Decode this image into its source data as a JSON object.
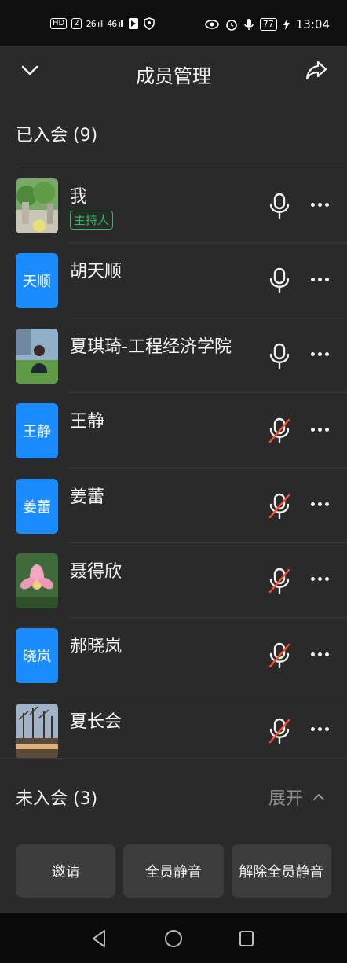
{
  "status_bar": {
    "left_chips": [
      "HD",
      "2"
    ],
    "signal_1": "26 ıll",
    "signal_2": "46 ıll",
    "battery": "77",
    "time": "13:04"
  },
  "header": {
    "title": "成员管理"
  },
  "joined": {
    "label": "已入会 (9)",
    "members": [
      {
        "name": "我",
        "badge": "主持人",
        "avatar_type": "photo-garden",
        "mic": "on"
      },
      {
        "name": "胡天顺",
        "avatar_text": "天顺",
        "avatar_type": "blue",
        "mic": "on"
      },
      {
        "name": "夏琪琦-工程经济学院",
        "avatar_type": "photo-person",
        "mic": "on"
      },
      {
        "name": "王静",
        "avatar_text": "王静",
        "avatar_type": "blue",
        "mic": "muted"
      },
      {
        "name": "姜蕾",
        "avatar_text": "姜蕾",
        "avatar_type": "blue",
        "mic": "muted"
      },
      {
        "name": "聂得欣",
        "avatar_type": "photo-lotus",
        "mic": "muted"
      },
      {
        "name": "郝晓岚",
        "avatar_text": "晓岚",
        "avatar_type": "blue",
        "mic": "muted"
      },
      {
        "name": "夏长会",
        "avatar_type": "photo-sunset",
        "mic": "muted"
      }
    ]
  },
  "not_joined": {
    "label": "未入会 (3)",
    "expand_label": "展开"
  },
  "actions": {
    "invite": "邀请",
    "mute_all": "全员静音",
    "unmute_all": "解除全员静音"
  },
  "colors": {
    "accent_blue": "#1a8cff",
    "host_green": "#2ebc61",
    "mute_red": "#ff4d2e"
  }
}
